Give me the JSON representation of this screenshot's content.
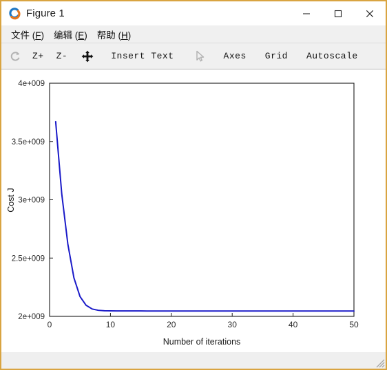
{
  "window": {
    "title": "Figure 1",
    "app_icon": "octave-logo-icon",
    "controls": {
      "minimize": "minimize-icon",
      "maximize": "maximize-icon",
      "close": "close-icon"
    }
  },
  "menubar": {
    "items": [
      {
        "label": "文件 (F)",
        "text": "文件 (",
        "accel": "F",
        "tail": ")"
      },
      {
        "label": "编辑 (E)",
        "text": "编辑 (",
        "accel": "E",
        "tail": ")"
      },
      {
        "label": "帮助 (H)",
        "text": "帮助 (",
        "accel": "H",
        "tail": ")"
      }
    ]
  },
  "toolbar": {
    "items": [
      {
        "name": "reset-rotation-icon",
        "label": "",
        "kind": "icon",
        "enabled": false
      },
      {
        "name": "zoom-in-button",
        "label": "Z+",
        "kind": "text",
        "enabled": true
      },
      {
        "name": "zoom-out-button",
        "label": "Z-",
        "kind": "text",
        "enabled": true
      },
      {
        "name": "pan-move-icon",
        "label": "",
        "kind": "icon",
        "enabled": true
      },
      {
        "name": "insert-text-button",
        "label": "Insert Text",
        "kind": "text",
        "enabled": true
      },
      {
        "name": "select-pointer-icon",
        "label": "",
        "kind": "icon",
        "enabled": false
      },
      {
        "name": "axes-button",
        "label": "Axes",
        "kind": "text",
        "enabled": true
      },
      {
        "name": "grid-button",
        "label": "Grid",
        "kind": "text",
        "enabled": true
      },
      {
        "name": "autoscale-button",
        "label": "Autoscale",
        "kind": "text",
        "enabled": true
      }
    ]
  },
  "chart_data": {
    "type": "line",
    "title": "",
    "xlabel": "Number of iterations",
    "ylabel": "Cost J",
    "xlim": [
      0,
      50
    ],
    "ylim": [
      2000000000,
      4000000000
    ],
    "xticks": [
      0,
      10,
      20,
      30,
      40,
      50
    ],
    "xticklabels": [
      "0",
      "10",
      "20",
      "30",
      "40",
      "50"
    ],
    "yticks": [
      2000000000,
      2500000000,
      3000000000,
      3500000000,
      4000000000
    ],
    "yticklabels": [
      "2e+009",
      "2.5e+009",
      "3e+009",
      "3.5e+009",
      "4e+009"
    ],
    "grid": false,
    "legend": null,
    "line_color": "#1a1ac8",
    "line_width": 2,
    "series": [
      {
        "name": "Cost J",
        "x": [
          1,
          2,
          3,
          4,
          5,
          6,
          7,
          8,
          9,
          10,
          11,
          12,
          13,
          14,
          15,
          16,
          17,
          18,
          19,
          20,
          21,
          22,
          23,
          24,
          25,
          26,
          27,
          28,
          29,
          30,
          31,
          32,
          33,
          34,
          35,
          36,
          37,
          38,
          39,
          40,
          41,
          42,
          43,
          44,
          45,
          46,
          47,
          48,
          49,
          50
        ],
        "values": [
          3670000000,
          3050000000,
          2620000000,
          2330000000,
          2170000000,
          2095000000,
          2063000000,
          2052000000,
          2048000000,
          2047000000,
          2046500000,
          2046300000,
          2046200000,
          2046150000,
          2046120000,
          2046100000,
          2046090000,
          2046085000,
          2046082000,
          2046080000,
          2046079000,
          2046078500,
          2046078200,
          2046078000,
          2046077900,
          2046077850,
          2046077820,
          2046077800,
          2046077790,
          2046077785,
          2046077782,
          2046077780,
          2046077779,
          2046077778,
          2046077777,
          2046077777,
          2046077776,
          2046077776,
          2046077776,
          2046077775,
          2046077775,
          2046077775,
          2046077775,
          2046077775,
          2046077775,
          2046077775,
          2046077775,
          2046077775,
          2046077775,
          2046077775
        ]
      }
    ]
  }
}
